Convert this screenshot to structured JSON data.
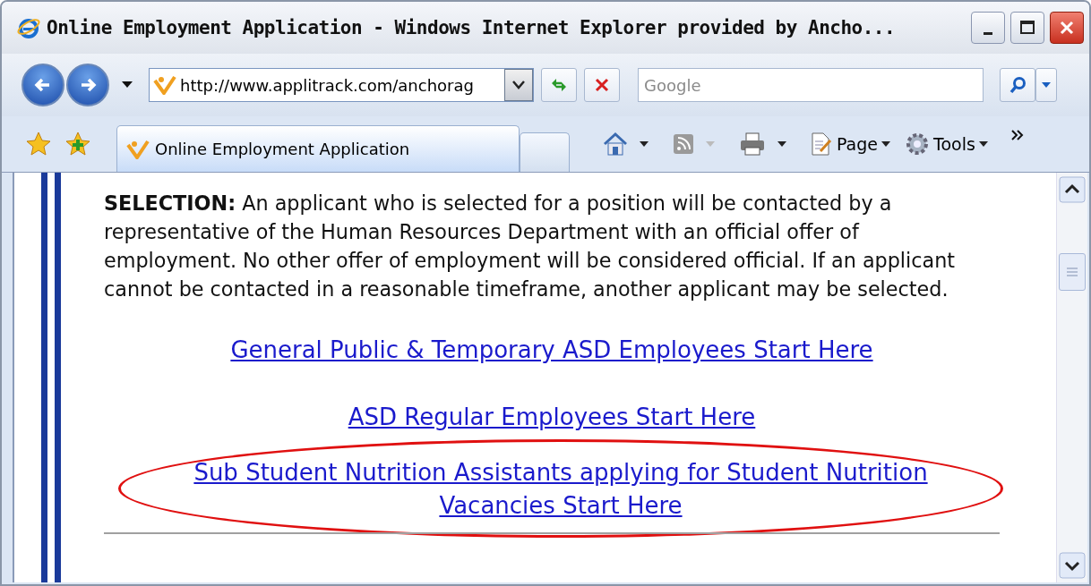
{
  "window": {
    "title": "Online Employment Application - Windows Internet Explorer provided by Ancho..."
  },
  "address": {
    "url": "http://www.applitrack.com/anchorag"
  },
  "search": {
    "placeholder": "Google"
  },
  "tabs": [
    {
      "label": "Online Employment Application",
      "selected": true
    },
    {
      "kind": "new",
      "selected": false
    }
  ],
  "command_bar": [
    {
      "kind": "home"
    },
    {
      "kind": "feeds",
      "disabled": true
    },
    {
      "kind": "print"
    },
    {
      "kind": "page",
      "label": "Page"
    },
    {
      "kind": "tools",
      "label": "Tools"
    }
  ],
  "content": {
    "paragraph": "**SELECTION:** An applicant who is selected for a position will be contacted by a representative of the Human Resources Department with an official offer of employment. No other offer of employment will be considered official. If an applicant cannot be contacted in a reasonable timeframe, another applicant may be selected.",
    "links": [
      {
        "text": "General Public & Temporary ASD Employees Start Here",
        "circled": false
      },
      {
        "text": "ASD Regular Employees Start Here",
        "circled": false
      },
      {
        "text": "Sub Student Nutrition Assistants applying for Student Nutrition Vacancies Start Here",
        "circled": true
      }
    ]
  }
}
